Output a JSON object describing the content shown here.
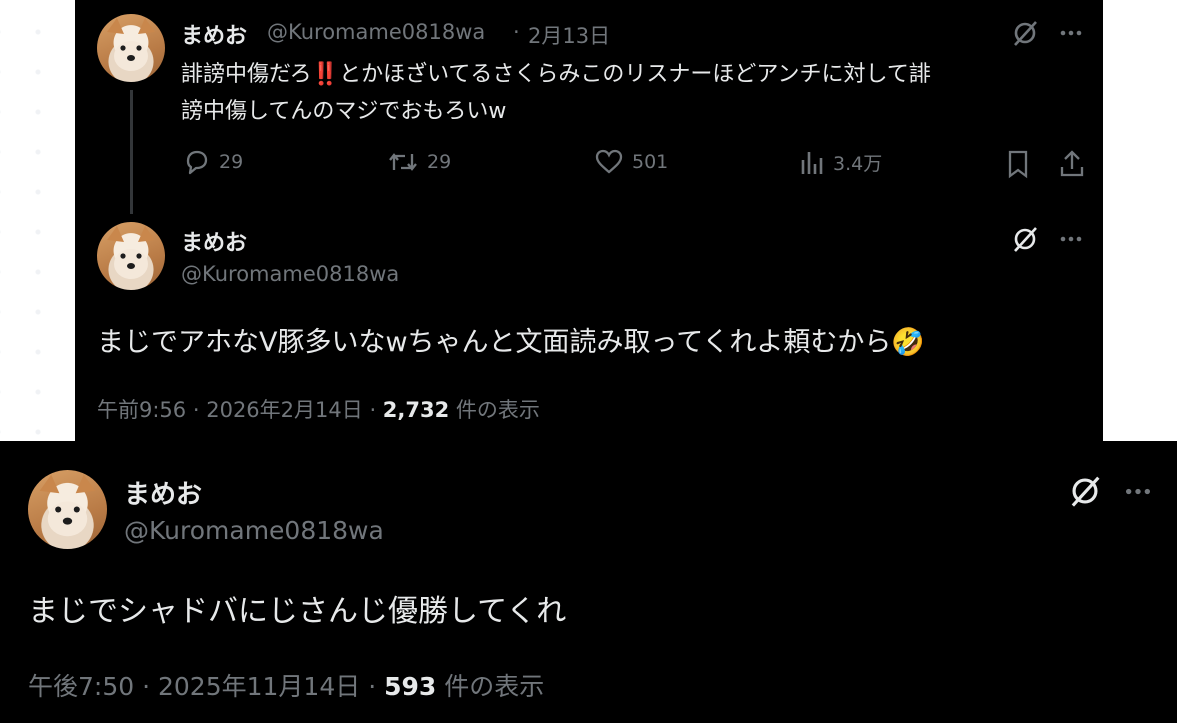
{
  "tweet_quoted": {
    "display_name": "まめお",
    "handle": "@Kuromame0818wa",
    "separator": "·",
    "date": "2月13日",
    "text_line1": "誹謗中傷だろ‼️とかほざいてるさくらみこのリスナーほどアンチに対して誹",
    "text_line2": "謗中傷してんのマジでおもろいw",
    "replies": "29",
    "retweets": "29",
    "likes": "501",
    "views": "3.4万"
  },
  "tweet_main": {
    "display_name": "まめお",
    "handle": "@Kuromame0818wa",
    "text": "まじでアホなV豚多いなwちゃんと文面読み取ってくれよ頼むから🤣",
    "time": "午前9:56",
    "date": "2026年2月14日",
    "views_count": "2,732",
    "views_label": "件の表示"
  },
  "tweet_bottom": {
    "display_name": "まめお",
    "handle": "@Kuromame0818wa",
    "text": "まじでシャドバにじさんじ優勝してくれ",
    "time": "午後7:50",
    "date": "2025年11月14日",
    "views_count": "593",
    "views_label": "件の表示"
  },
  "icons": {
    "grok": "grok-icon",
    "more": "more-icon",
    "reply": "reply-icon",
    "retweet": "retweet-icon",
    "like": "heart-icon",
    "views": "views-icon",
    "bookmark": "bookmark-icon",
    "share": "share-icon"
  },
  "colors": {
    "background": "#000000",
    "text": "#e7e9ea",
    "secondary": "#71767b",
    "thread_line": "#333639"
  }
}
